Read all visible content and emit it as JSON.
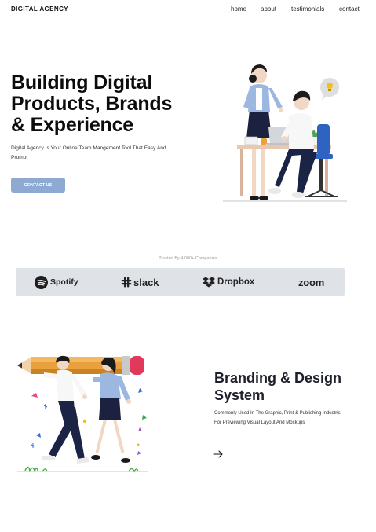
{
  "nav": {
    "brand": "DIGITAL AGENCY",
    "links": [
      "home",
      "about",
      "testimonials",
      "contact"
    ]
  },
  "hero": {
    "title_lines": [
      "Building Digital",
      "Products, Brands",
      "& Experience"
    ],
    "subtitle": "Digital Agency Is Your Online Team Mangement Tool That Easy And Prompt",
    "cta_label": "CONTACT US",
    "illustration_icon": "team-at-desk-illustration"
  },
  "trusted": {
    "label": "Trusted By 4,000+ Companies",
    "companies": [
      "Spotify",
      "slack",
      "Dropbox",
      "zoom"
    ]
  },
  "feature": {
    "title_lines": [
      "Branding & Design",
      "System"
    ],
    "text": "Commonly Used In The Graphic, Print & Publishing Industris For Previewing Visual Layout And Mockups",
    "arrow_icon": "arrow-right-icon",
    "illustration_icon": "people-carrying-pencil-illustration"
  },
  "colors": {
    "cta": "#8eaad2",
    "logos_bar": "#dfe2e6",
    "heading": "#0c0c0c",
    "feature_heading": "#1d1f2b"
  }
}
